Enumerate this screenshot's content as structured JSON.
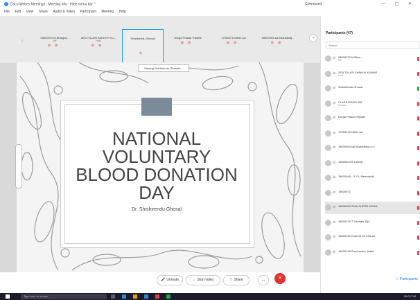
{
  "window": {
    "app_title": "Cisco Webex Meetings · Meeting info · Hide menu bar ^",
    "connection": "Connected ·",
    "controls": "— ▢ ✕"
  },
  "menu": [
    "File",
    "Edit",
    "View",
    "Share",
    "Audio & Video",
    "Participant",
    "Meeting",
    "Help"
  ],
  "strip": {
    "tiles": [
      {
        "name": "08000070 M.Bhargav...",
        "sub": "Me"
      },
      {
        "name": "ZEN TULASI SANKHY KU...",
        "sub": "Host"
      },
      {
        "name": "Shishirendu Ghosal",
        "sub": ""
      },
      {
        "name": "Durga Prasad Tripathi",
        "sub": ""
      },
      {
        "name": "17000476 Nithin sai",
        "sub": ""
      },
      {
        "name": "18000593 sai bharadwaj...",
        "sub": ""
      }
    ],
    "tooltip": "Viewing Shishirendu Ghosal's..."
  },
  "slide": {
    "title_lines": [
      "NATIONAL VOLUNTARY",
      "BLOOD DONATION",
      "DAY"
    ],
    "author": "Dr. Shishirendu Ghosal"
  },
  "controls": {
    "unmute": "Unmute",
    "start_video": "Start video",
    "share": "Share",
    "more": "...",
    "end": "✕"
  },
  "participants": {
    "header": "Participants (47)",
    "search_placeholder": "Search",
    "button_label": "Participants",
    "list": [
      {
        "name": "08000070 M.Bhar...",
        "role": "Me",
        "status": "red"
      },
      {
        "name": "ZEN TULASI SANKHY KUMAR",
        "role": "Host",
        "status": "red"
      },
      {
        "name": "Shishirendu Ghosal",
        "role": "",
        "status": "green"
      },
      {
        "name": "CLASS ROOM 205",
        "role": "Cohost",
        "status": "red"
      },
      {
        "name": "Durga Prasad Tripathi",
        "role": "",
        "status": "red"
      },
      {
        "name": "17000476 Nithin sai",
        "role": "",
        "status": "red"
      },
      {
        "name": "18000593 sai bharadwaj c c c",
        "role": "",
        "status": "red"
      },
      {
        "name": "18000623 B.Lokesh",
        "role": "",
        "status": "red"
      },
      {
        "name": "18000049 - D.S.L.Meenakshi",
        "role": "",
        "status": "red"
      },
      {
        "name": "18000072",
        "role": "",
        "status": "red"
      },
      {
        "name": "18000092 SHAI SUPER KIRAN",
        "role": "",
        "status": "red"
      },
      {
        "name": "18000135 T. Venkata Sija",
        "role": "",
        "status": "red"
      },
      {
        "name": "18000140 Channa Sri Charan",
        "role": "",
        "status": "red"
      },
      {
        "name": "18000148 Sreeharsha Jadda",
        "role": "",
        "status": "red"
      }
    ]
  },
  "taskbar": {
    "search": "Type here to search",
    "clock": "09:02 PM"
  }
}
